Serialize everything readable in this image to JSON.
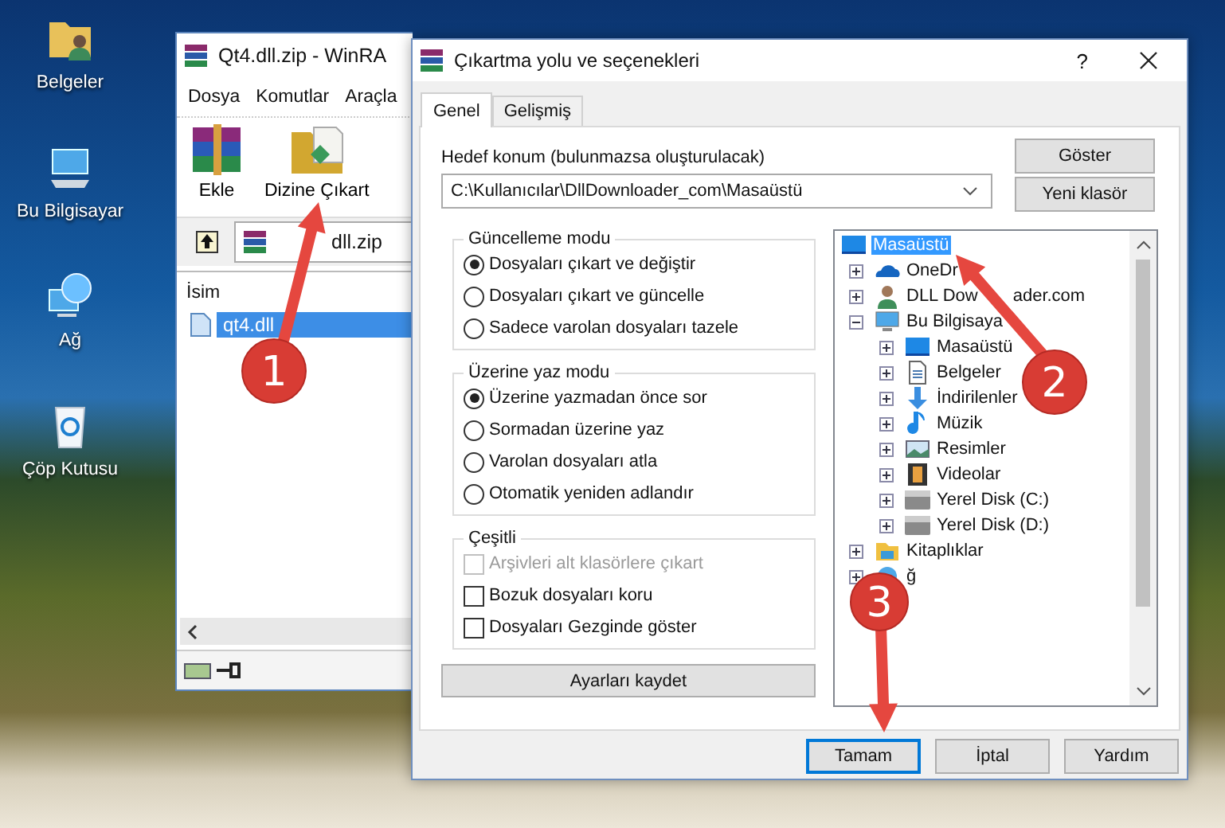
{
  "desktop": {
    "icons": [
      {
        "label": "Belgeler",
        "kind": "documents"
      },
      {
        "label": "Bu Bilgisayar",
        "kind": "computer"
      },
      {
        "label": "Ağ",
        "kind": "network"
      },
      {
        "label": "Çöp Kutusu",
        "kind": "recycle"
      }
    ]
  },
  "archive_window": {
    "title": "Qt4.dll.zip - WinRA",
    "menu": [
      "Dosya",
      "Komutlar",
      "Araçla"
    ],
    "toolbar": [
      {
        "label": "Ekle",
        "kind": "add"
      },
      {
        "label": "Dizine Çıkart",
        "kind": "extract"
      }
    ],
    "address": "dll.zip",
    "column": "İsim",
    "files": [
      {
        "name": "qt4.dll",
        "selected": true
      }
    ]
  },
  "dialog": {
    "title": "Çıkartma yolu ve seçenekleri",
    "help": "?",
    "tabs": [
      {
        "label": "Genel",
        "selected": true
      },
      {
        "label": "Gelişmiş",
        "selected": false
      }
    ],
    "destination": {
      "label": "Hedef konum (bulunmazsa oluşturulacak)",
      "value": "C:\\Kullanıcılar\\DllDownloader_com\\Masaüstü"
    },
    "side_buttons": [
      "Göster",
      "Yeni klasör"
    ],
    "groups": [
      {
        "title": "Güncelleme modu",
        "options": [
          {
            "kind": "radio",
            "label": "Dosyaları çıkart ve değiştir",
            "selected": true
          },
          {
            "kind": "radio",
            "label": "Dosyaları çıkart ve güncelle",
            "selected": false
          },
          {
            "kind": "radio",
            "label": "Sadece varolan dosyaları tazele",
            "selected": false
          }
        ]
      },
      {
        "title": "Üzerine yaz modu",
        "options": [
          {
            "kind": "radio",
            "label": "Üzerine yazmadan önce sor",
            "selected": true
          },
          {
            "kind": "radio",
            "label": "Sormadan üzerine yaz",
            "selected": false
          },
          {
            "kind": "radio",
            "label": "Varolan dosyaları atla",
            "selected": false
          },
          {
            "kind": "radio",
            "label": "Otomatik yeniden adlandır",
            "selected": false
          }
        ]
      },
      {
        "title": "Çeşitli",
        "options": [
          {
            "kind": "checkbox",
            "label": "Arşivleri alt klasörlere çıkart",
            "checked": false,
            "disabled": true
          },
          {
            "kind": "checkbox",
            "label": "Bozuk dosyaları koru",
            "checked": false,
            "disabled": false
          },
          {
            "kind": "checkbox",
            "label": "Dosyaları Gezginde göster",
            "checked": false,
            "disabled": false
          }
        ]
      }
    ],
    "save_button": "Ayarları kaydet",
    "tree": [
      {
        "label": "Masaüstü",
        "kind": "desktop",
        "selected": true,
        "children": [
          {
            "label": "OneDr",
            "kind": "cloud",
            "selected": false,
            "expanded": false
          },
          {
            "label": "DLL Dow",
            "label_tail": "ader.com",
            "kind": "user",
            "selected": false,
            "expanded": false
          },
          {
            "label": "Bu Bilgisaya",
            "kind": "computer",
            "selected": false,
            "expanded": true,
            "children": [
              {
                "label": "Masaüstü",
                "kind": "desktop",
                "selected": false,
                "expanded": false
              },
              {
                "label": "Belgeler",
                "kind": "document",
                "selected": false,
                "expanded": false
              },
              {
                "label": "İndirilenler",
                "kind": "download",
                "selected": false,
                "expanded": false
              },
              {
                "label": "Müzik",
                "kind": "music",
                "selected": false,
                "expanded": false
              },
              {
                "label": "Resimler",
                "kind": "picture",
                "selected": false,
                "expanded": false
              },
              {
                "label": "Videolar",
                "kind": "video",
                "selected": false,
                "expanded": false
              },
              {
                "label": "Yerel Disk (C:)",
                "kind": "disk",
                "selected": false,
                "expanded": false
              },
              {
                "label": "Yerel Disk (D:)",
                "kind": "disk",
                "selected": false,
                "expanded": false
              }
            ]
          },
          {
            "label": "Kitaplıklar",
            "kind": "library",
            "selected": false,
            "expanded": false
          },
          {
            "label": "ğ",
            "kind": "network",
            "selected": false,
            "expanded": false
          }
        ]
      }
    ],
    "buttons": [
      {
        "label": "Tamam",
        "focused": true
      },
      {
        "label": "İptal",
        "focused": false
      },
      {
        "label": "Yardım",
        "focused": false
      }
    ]
  },
  "annotations": [
    {
      "number": "1"
    },
    {
      "number": "2"
    },
    {
      "number": "3"
    }
  ]
}
